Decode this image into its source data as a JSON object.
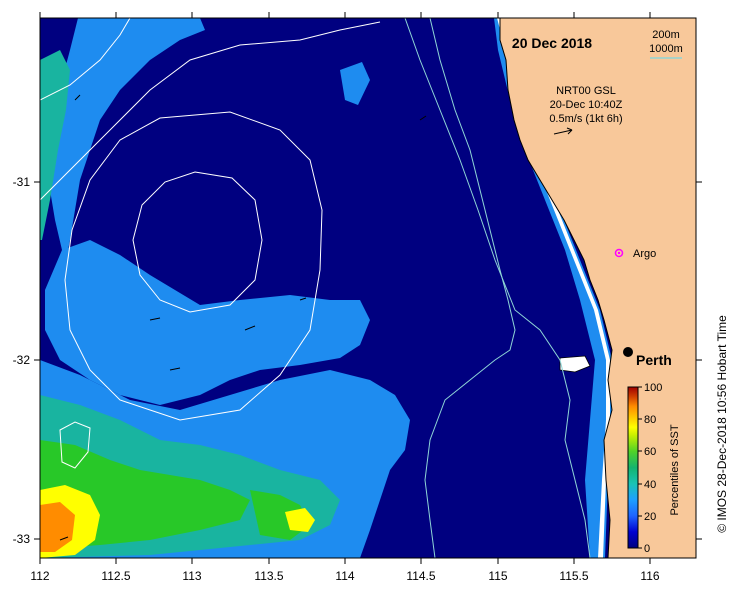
{
  "date_label": "20 Dec 2018",
  "depth_contours": [
    "200m",
    "1000m"
  ],
  "product": {
    "line1": "NRT00 GSL",
    "line2": "20-Dec 10:40Z",
    "line3": "0.5m/s (1kt 6h)"
  },
  "places": {
    "argo": "Argo",
    "perth": "Perth"
  },
  "colorbar": {
    "title": "Percentiles of SST",
    "ticks": [
      "100",
      "80",
      "60",
      "40",
      "20",
      "0"
    ],
    "colors": [
      "#000080",
      "#0000c8",
      "#1e64ff",
      "#1e9bff",
      "#19c3c3",
      "#14b46e",
      "#28c828",
      "#96dc32",
      "#ffff00",
      "#ffc800",
      "#ff8c00",
      "#dc5000",
      "#b41e00",
      "#a00000"
    ]
  },
  "x_axis_ticks": [
    "112",
    "112.5",
    "113",
    "113.5",
    "114",
    "114.5",
    "115",
    "115.5",
    "116"
  ],
  "y_axis_ticks": [
    "-31",
    "-32",
    "-33"
  ],
  "credit": "© IMOS 28-Dec-2018 10:56 Hobart Time",
  "colors": {
    "deep_ocean": "#000080",
    "mid_blue": "#1e8cf0",
    "teal": "#19b4a0",
    "green": "#28c828",
    "yellow": "#ffff00",
    "orange": "#ff8c00",
    "land": "#f8c89a",
    "contour": "#8fd6d6",
    "eddy_line": "#ffffff"
  }
}
